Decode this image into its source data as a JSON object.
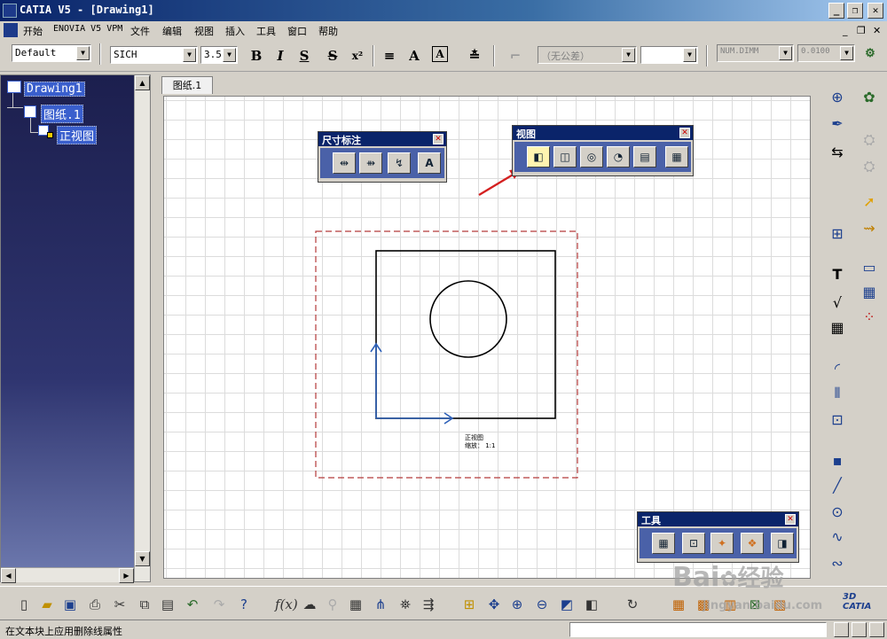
{
  "window": {
    "title": "CATIA V5 - [Drawing1]",
    "min_label": "_",
    "restore_label": "❐",
    "close_label": "✕"
  },
  "menu": {
    "items": [
      "开始",
      "ENOVIA V5 VPM",
      "文件",
      "编辑",
      "视图",
      "插入",
      "工具",
      "窗口",
      "帮助"
    ],
    "mdi_buttons": [
      "_",
      "❐",
      "✕"
    ]
  },
  "toolbar": {
    "style_combo": "Default",
    "font_combo": "SICH",
    "size_combo": "3.5",
    "bold_label": "B",
    "italic_label": "I",
    "underline_label": "S",
    "strike_label": "S",
    "superscript_label": "x²",
    "tolerance_combo": "（无公差）",
    "blank_combo": "",
    "dim_combo": "NUM.DIMM",
    "precision_combo": "0.0100"
  },
  "tree": {
    "root_label": "Drawing1",
    "sheet_label": "图纸.1",
    "view_label": "正视图"
  },
  "canvas": {
    "tab_label": "图纸.1",
    "view_caption_line1": "正视图",
    "view_caption_line2": "缩放：  1:1",
    "colors": {
      "frame": "#b33a3a",
      "axis": "#2d60b8",
      "arrow": "#d42020",
      "palette_title": "#0a246a"
    }
  },
  "palettes": {
    "dimension": {
      "title": "尺寸标注",
      "icons": [
        "dimensions-icon",
        "chained-dimension-icon",
        "leader-dimension-icon",
        "text-dimension-icon"
      ]
    },
    "views": {
      "title": "视图",
      "icons": [
        "front-view-icon",
        "section-view-icon",
        "detail-view-icon",
        "clipping-view-icon",
        "broken-view-icon",
        "wizard-icon"
      ]
    },
    "tools": {
      "title": "工具",
      "icons": [
        "grid-icon",
        "snap-icon",
        "analysis-icon",
        "dimension-system-icon",
        "filter-icon"
      ]
    }
  },
  "status": {
    "message": "在文本块上应用删除线属性"
  },
  "watermark": {
    "line1": "Bai",
    "line2": "经验",
    "line3": "jingyan.baidu.com"
  }
}
